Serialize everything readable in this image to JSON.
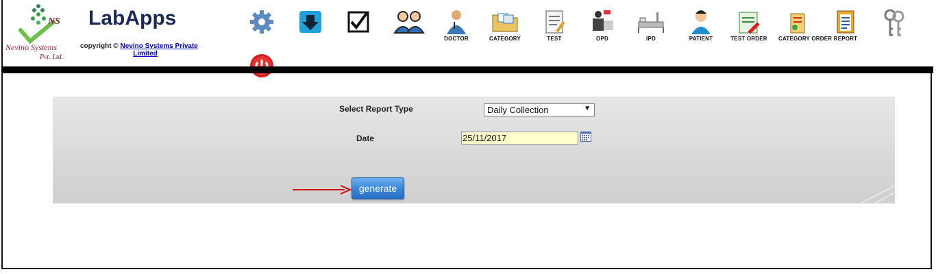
{
  "logo": {
    "ns": "NS",
    "company_line1": "Nevino Systems",
    "company_line2": "Pvt. Ltd."
  },
  "app": {
    "title": "LabApps"
  },
  "copyright": {
    "prefix": "copyright ©",
    "link_line1": "Nevino Systems Private",
    "link_line2": "Limited"
  },
  "toolbar": {
    "items": [
      {
        "icon": "gear-icon",
        "label": ""
      },
      {
        "icon": "download-icon",
        "label": ""
      },
      {
        "icon": "checkbox-icon",
        "label": ""
      },
      {
        "icon": "users-icon",
        "label": ""
      },
      {
        "icon": "doctor-icon",
        "label": "DOCTOR"
      },
      {
        "icon": "folder-icon",
        "label": "CATEGORY"
      },
      {
        "icon": "test-icon",
        "label": "TEST"
      },
      {
        "icon": "opd-icon",
        "label": "OPD"
      },
      {
        "icon": "ipd-bed-icon",
        "label": "IPD"
      },
      {
        "icon": "patient-icon",
        "label": "PATIENT"
      },
      {
        "icon": "test-order-icon",
        "label": "TEST ORDER"
      },
      {
        "icon": "category-order-icon",
        "label": "CATEGORY ORDER"
      },
      {
        "icon": "report-icon",
        "label": "REPORT"
      },
      {
        "icon": "keys-icon",
        "label": ""
      }
    ],
    "logout_icon": "power-icon"
  },
  "form": {
    "report_type_label": "Select Report Type",
    "report_type_value": "Daily Collection",
    "date_label": "Date",
    "date_value": "25/11/2017",
    "generate_label": "generate"
  },
  "colors": {
    "accent_blue": "#3a86d8",
    "date_bg": "#ffffcc",
    "arrow": "#cc1111",
    "brand": "#1a2a55"
  }
}
